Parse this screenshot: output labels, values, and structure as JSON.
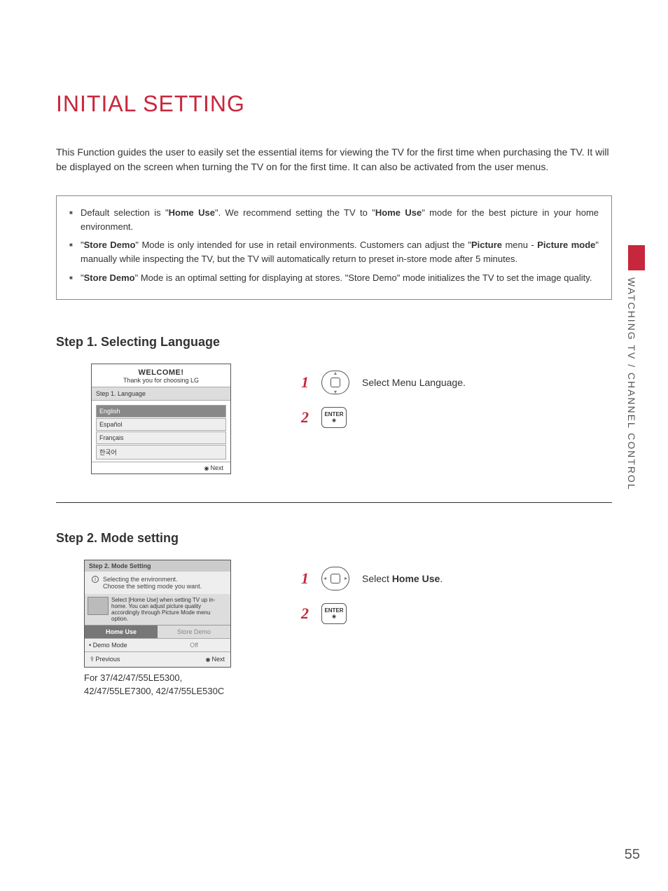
{
  "page_number": "55",
  "side_section": "WATCHING TV / CHANNEL CONTROL",
  "title": "INITIAL SETTING",
  "intro": "This Function guides the user to easily set the essential items for viewing the TV for the first time when purchasing the TV. It will be displayed on the screen when turning the TV on for the first time. It can also be activated from the user menus.",
  "notes": {
    "n1_pre": "Default selection is \"",
    "n1_b1": "Home Use",
    "n1_mid": "\". We recommend setting the TV to \"",
    "n1_b2": "Home Use",
    "n1_post": "\" mode for the best picture in your home environment.",
    "n2_pre": "\"",
    "n2_b1": "Store Demo",
    "n2_mid1": "\" Mode is only intended for use in retail environments. Customers can adjust the \"",
    "n2_b2": "Picture",
    "n2_mid2": " menu - ",
    "n2_b3": "Picture mode",
    "n2_post": "\" manually while inspecting the TV, but the TV will automatically return to preset in-store mode after 5 minutes.",
    "n3_pre": "\"",
    "n3_b1": "Store Demo",
    "n3_post": "\" Mode is an optimal setting for displaying at stores. \"Store Demo\" mode initializes the TV to set the image quality."
  },
  "step1": {
    "heading": "Step 1. Selecting Language",
    "welcome": "WELCOME!",
    "thanks": "Thank you for choosing LG",
    "stepline": "Step 1. Language",
    "langs": [
      "English",
      "Español",
      "Français",
      "한국어"
    ],
    "next": "Next",
    "num1": "1",
    "num2": "2",
    "enter": "ENTER",
    "desc": "Select Menu Language."
  },
  "step2": {
    "heading": "Step 2. Mode setting",
    "head2": "Step 2. Mode Setting",
    "env1": "Selecting the environment.",
    "env2": "Choose the setting mode you want.",
    "hint": "Select [Home Use] when setting TV up in-home. You can adjust picture quality accordingly through Picture Mode menu option.",
    "home_use": "Home Use",
    "store_demo": "Store Demo",
    "demo_label": "• Demo Mode",
    "demo_val": "Off",
    "prev": "Previous",
    "next": "Next",
    "models": "For 37/42/47/55LE5300, 42/47/55LE7300, 42/47/55LE530C",
    "num1": "1",
    "num2": "2",
    "enter": "ENTER",
    "desc_pre": "Select ",
    "desc_bold": "Home Use",
    "desc_post": "."
  }
}
